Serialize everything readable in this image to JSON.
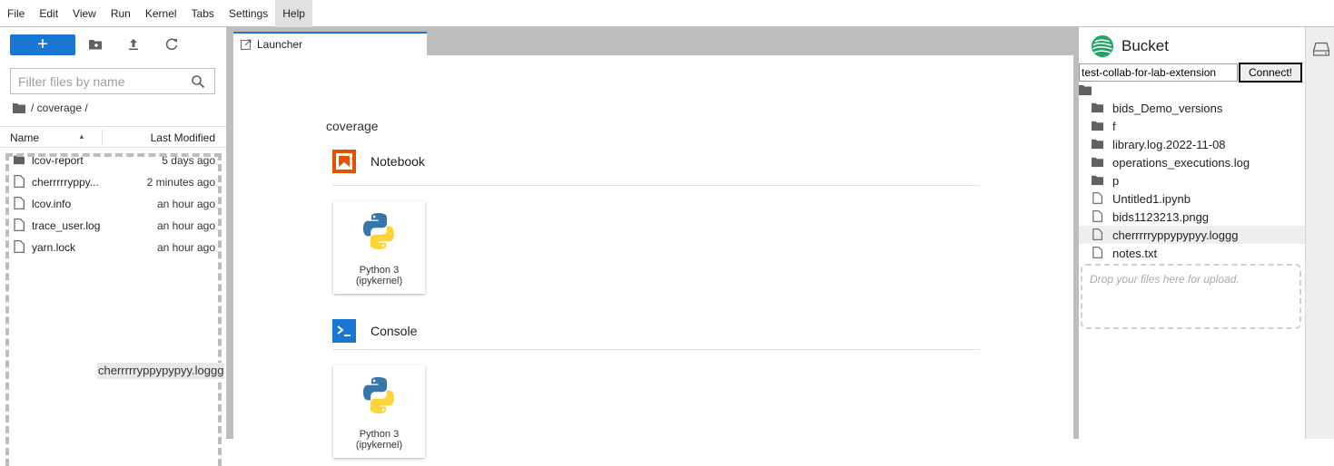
{
  "menu": [
    "File",
    "Edit",
    "View",
    "Run",
    "Kernel",
    "Tabs",
    "Settings",
    "Help"
  ],
  "file_browser": {
    "new_label": "+",
    "filter_placeholder": "Filter files by name",
    "breadcrumb": "/ coverage /",
    "columns": {
      "name": "Name",
      "modified": "Last Modified"
    },
    "files": [
      {
        "name": "lcov-report",
        "modified": "5 days ago",
        "kind": "folder"
      },
      {
        "name": "cherrrrryppy...",
        "modified": "2 minutes ago",
        "kind": "file"
      },
      {
        "name": "lcov.info",
        "modified": "an hour ago",
        "kind": "file"
      },
      {
        "name": "trace_user.log",
        "modified": "an hour ago",
        "kind": "file"
      },
      {
        "name": "yarn.lock",
        "modified": "an hour ago",
        "kind": "file"
      }
    ],
    "drag_ghost": "cherrrrryppypypyy.loggg"
  },
  "tab": {
    "label": "Launcher"
  },
  "launcher": {
    "cwd": "coverage",
    "notebook_section": "Notebook",
    "console_section": "Console",
    "kernel_line1": "Python 3",
    "kernel_line2": "(ipykernel)"
  },
  "bucket": {
    "title": "Bucket",
    "bucket_name": "test-collab-for-lab-extension",
    "connect_label": "Connect!",
    "items": [
      {
        "name": "bids_Demo_versions",
        "kind": "folder"
      },
      {
        "name": "f",
        "kind": "folder"
      },
      {
        "name": "library.log.2022-11-08",
        "kind": "folder"
      },
      {
        "name": "operations_executions.log",
        "kind": "folder"
      },
      {
        "name": "p",
        "kind": "folder"
      },
      {
        "name": "Untitled1.ipynb",
        "kind": "file"
      },
      {
        "name": "bids1123213.pngg",
        "kind": "file"
      },
      {
        "name": "cherrrrryppypypyy.loggg",
        "kind": "file"
      },
      {
        "name": "notes.txt",
        "kind": "file"
      }
    ],
    "selected_index": 7,
    "upload_placeholder": "Drop your files here for upload."
  },
  "colors": {
    "accent": "#1976d2",
    "notebook_icon": "#e65100",
    "console_icon": "#1976d2"
  }
}
